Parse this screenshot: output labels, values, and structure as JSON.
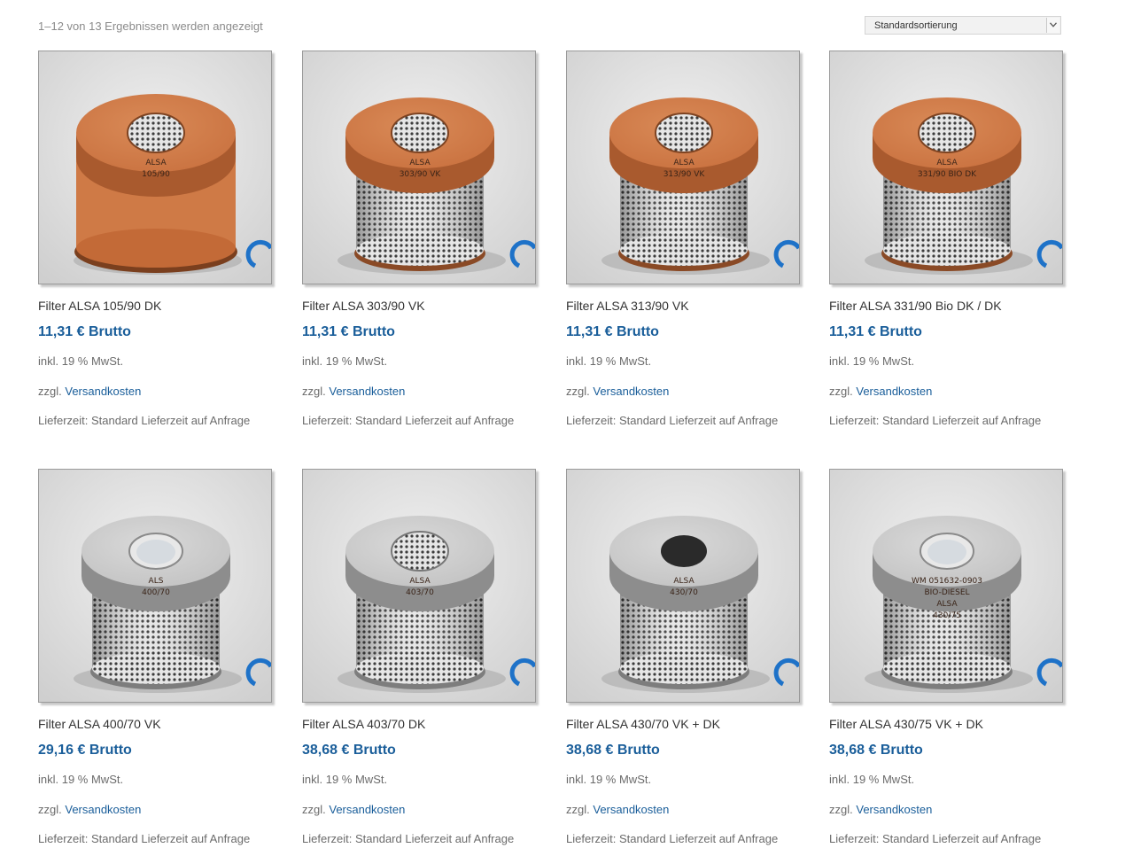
{
  "toolbar": {
    "result_count": "1–12 von 13 Ergebnissen werden angezeigt",
    "sort": {
      "selected": "Standardsortierung"
    }
  },
  "products": [
    {
      "title": "Filter ALSA 105/90 DK",
      "price": "11,31 € Brutto",
      "tax": "inkl. 19 % MwSt.",
      "shipping_prefix": "zzgl.",
      "shipping_link": "Versandkosten",
      "delivery": "Lieferzeit: Standard Lieferzeit auf Anfrage",
      "image": {
        "cap": "orange-rubber",
        "body": "orange",
        "label_lines": [
          "ALSA",
          "105/90"
        ]
      }
    },
    {
      "title": "Filter ALSA 303/90 VK",
      "price": "11,31 € Brutto",
      "tax": "inkl. 19 % MwSt.",
      "shipping_prefix": "zzgl.",
      "shipping_link": "Versandkosten",
      "delivery": "Lieferzeit: Standard Lieferzeit auf Anfrage",
      "image": {
        "cap": "orange-rubber",
        "body": "mesh",
        "label_lines": [
          "ALSA",
          "303/90 VK"
        ]
      }
    },
    {
      "title": "Filter ALSA 313/90 VK",
      "price": "11,31 € Brutto",
      "tax": "inkl. 19 % MwSt.",
      "shipping_prefix": "zzgl.",
      "shipping_link": "Versandkosten",
      "delivery": "Lieferzeit: Standard Lieferzeit auf Anfrage",
      "image": {
        "cap": "orange-rubber",
        "body": "mesh",
        "label_lines": [
          "ALSA",
          "313/90 VK"
        ]
      }
    },
    {
      "title": "Filter ALSA 331/90 Bio DK / DK",
      "price": "11,31 € Brutto",
      "tax": "inkl. 19 % MwSt.",
      "shipping_prefix": "zzgl.",
      "shipping_link": "Versandkosten",
      "delivery": "Lieferzeit: Standard Lieferzeit auf Anfrage",
      "image": {
        "cap": "orange-rubber",
        "body": "mesh",
        "label_lines": [
          "ALSA",
          "331/90 BIO DK"
        ]
      }
    },
    {
      "title": "Filter ALSA 400/70 VK",
      "price": "29,16 € Brutto",
      "tax": "inkl. 19 % MwSt.",
      "shipping_prefix": "zzgl.",
      "shipping_link": "Versandkosten",
      "delivery": "Lieferzeit: Standard Lieferzeit auf Anfrage",
      "image": {
        "cap": "aluminium-closed",
        "body": "mesh",
        "label_lines": [
          "ALS",
          "400/70"
        ]
      }
    },
    {
      "title": "Filter ALSA 403/70 DK",
      "price": "38,68 € Brutto",
      "tax": "inkl. 19 % MwSt.",
      "shipping_prefix": "zzgl.",
      "shipping_link": "Versandkosten",
      "delivery": "Lieferzeit: Standard Lieferzeit auf Anfrage",
      "image": {
        "cap": "aluminium-open",
        "body": "mesh",
        "label_lines": [
          "ALSA",
          "403/70"
        ]
      }
    },
    {
      "title": "Filter ALSA 430/70 VK + DK",
      "price": "38,68 € Brutto",
      "tax": "inkl. 19 % MwSt.",
      "shipping_prefix": "zzgl.",
      "shipping_link": "Versandkosten",
      "delivery": "Lieferzeit: Standard Lieferzeit auf Anfrage",
      "image": {
        "cap": "aluminium-dark",
        "body": "mesh",
        "label_lines": [
          "ALSA",
          "430/70"
        ]
      }
    },
    {
      "title": "Filter ALSA 430/75 VK + DK",
      "price": "38,68 € Brutto",
      "tax": "inkl. 19 % MwSt.",
      "shipping_prefix": "zzgl.",
      "shipping_link": "Versandkosten",
      "delivery": "Lieferzeit: Standard Lieferzeit auf Anfrage",
      "image": {
        "cap": "aluminium-closed",
        "body": "mesh",
        "label_lines": [
          "WM 051632-0903",
          "BIO-DIESEL",
          "ALSA",
          "430/75"
        ]
      }
    }
  ],
  "colors": {
    "link": "#1a5e9a",
    "price": "#1a5e9a",
    "text": "#333333",
    "muted": "#6b6b6b",
    "orange_cap": "#c8703e",
    "aluminium": "#bcbcbc"
  }
}
